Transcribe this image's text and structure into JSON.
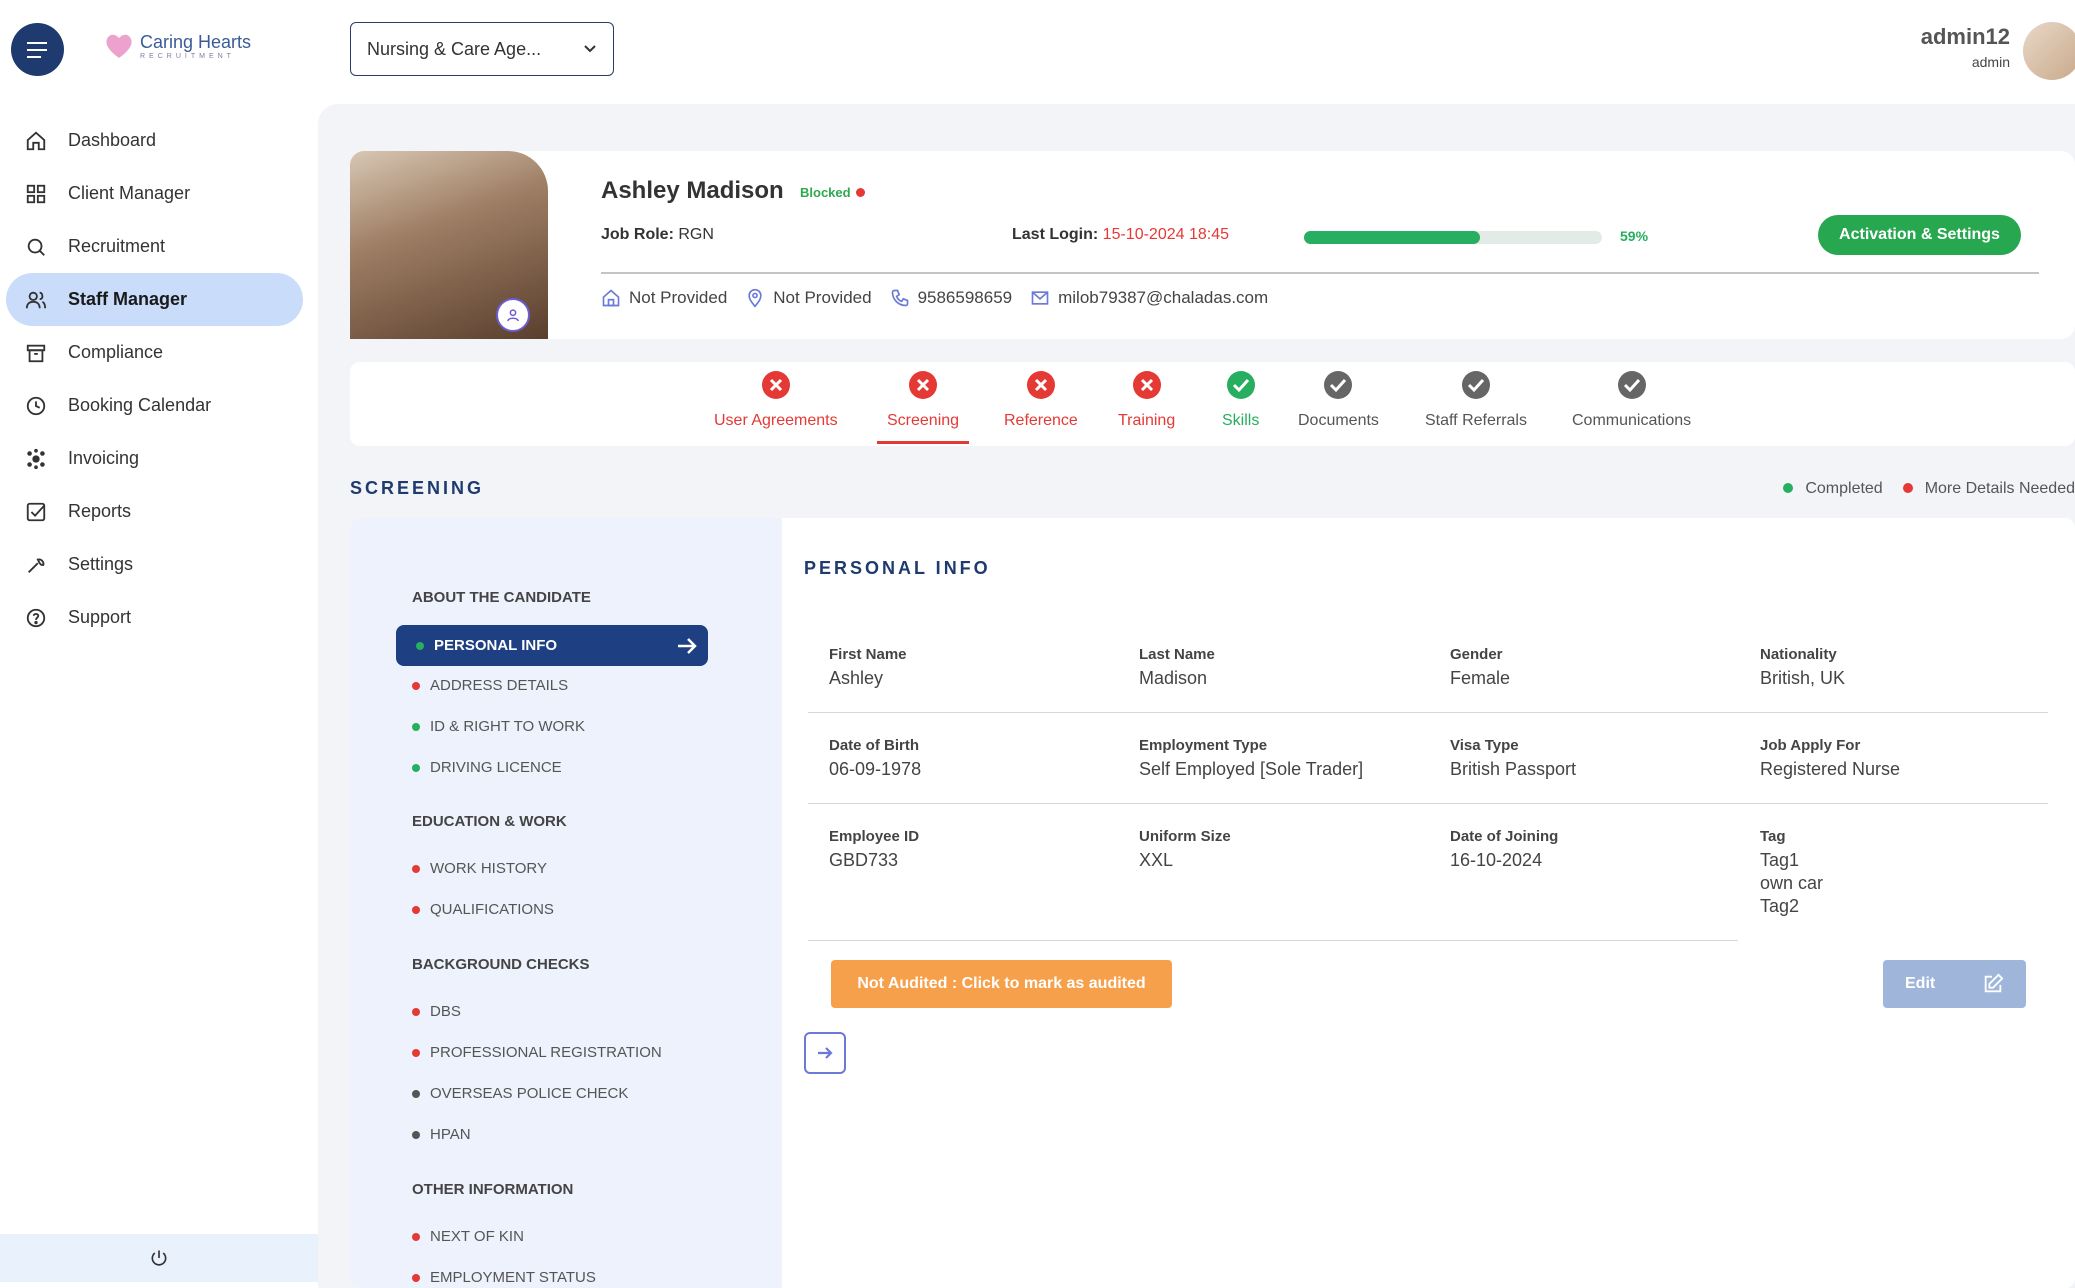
{
  "brand": {
    "name": "Caring Hearts",
    "sub": "RECRUITMENT"
  },
  "agency_select": {
    "value": "Nursing & Care Age..."
  },
  "user": {
    "name": "admin12",
    "role": "admin"
  },
  "sidebar": {
    "items": [
      {
        "label": "Dashboard",
        "icon": "home-icon"
      },
      {
        "label": "Client Manager",
        "icon": "grid-icon"
      },
      {
        "label": "Recruitment",
        "icon": "search-icon"
      },
      {
        "label": "Staff Manager",
        "icon": "users-icon"
      },
      {
        "label": "Compliance",
        "icon": "archive-icon"
      },
      {
        "label": "Booking Calendar",
        "icon": "clock-icon"
      },
      {
        "label": "Invoicing",
        "icon": "cog-icon"
      },
      {
        "label": "Reports",
        "icon": "checkbox-icon"
      },
      {
        "label": "Settings",
        "icon": "wrench-icon"
      },
      {
        "label": "Support",
        "icon": "help-icon"
      }
    ]
  },
  "candidate": {
    "name": "Ashley Madison",
    "status": "Blocked",
    "job_role_label": "Job Role:",
    "job_role": "RGN",
    "last_login_label": "Last Login:",
    "last_login": "15-10-2024 18:45",
    "progress": 59,
    "progress_label": "59%",
    "activation_button": "Activation & Settings",
    "address": "Not Provided",
    "location": "Not Provided",
    "phone": "9586598659",
    "email": "milob79387@chaladas.com"
  },
  "tabs": [
    {
      "label": "User Agreements",
      "state": "error"
    },
    {
      "label": "Screening",
      "state": "error"
    },
    {
      "label": "Reference",
      "state": "error"
    },
    {
      "label": "Training",
      "state": "error"
    },
    {
      "label": "Skills",
      "state": "complete"
    },
    {
      "label": "Documents",
      "state": "neutral"
    },
    {
      "label": "Staff Referrals",
      "state": "neutral"
    },
    {
      "label": "Communications",
      "state": "neutral"
    }
  ],
  "screening": {
    "title": "SCREENING",
    "legend": {
      "completed": "Completed",
      "more": "More Details Needed"
    },
    "groups": [
      {
        "title": "ABOUT THE CANDIDATE",
        "items": [
          {
            "label": "PERSONAL INFO",
            "status": "green"
          },
          {
            "label": "ADDRESS DETAILS",
            "status": "red"
          },
          {
            "label": "ID & RIGHT TO WORK",
            "status": "green"
          },
          {
            "label": "DRIVING LICENCE",
            "status": "green"
          }
        ]
      },
      {
        "title": "EDUCATION & WORK",
        "items": [
          {
            "label": "WORK HISTORY",
            "status": "red"
          },
          {
            "label": "QUALIFICATIONS",
            "status": "red"
          }
        ]
      },
      {
        "title": "BACKGROUND CHECKS",
        "items": [
          {
            "label": "DBS",
            "status": "red"
          },
          {
            "label": "PROFESSIONAL REGISTRATION",
            "status": "red"
          },
          {
            "label": "OVERSEAS POLICE CHECK",
            "status": "grey"
          },
          {
            "label": "HPAN",
            "status": "grey"
          }
        ]
      },
      {
        "title": "OTHER INFORMATION",
        "items": [
          {
            "label": "NEXT OF KIN",
            "status": "red"
          },
          {
            "label": "EMPLOYMENT STATUS",
            "status": "red"
          }
        ]
      }
    ]
  },
  "personal_info": {
    "title": "PERSONAL INFO",
    "fields": [
      {
        "label": "First Name",
        "value": "Ashley"
      },
      {
        "label": "Last Name",
        "value": "Madison"
      },
      {
        "label": "Gender",
        "value": "Female"
      },
      {
        "label": "Nationality",
        "value": "British, UK"
      },
      {
        "label": "Date of Birth",
        "value": "06-09-1978"
      },
      {
        "label": "Employment Type",
        "value": "Self Employed [Sole Trader]"
      },
      {
        "label": "Visa Type",
        "value": "British Passport"
      },
      {
        "label": "Job Apply For",
        "value": "Registered Nurse"
      },
      {
        "label": "Employee ID",
        "value": "GBD733"
      },
      {
        "label": "Uniform Size",
        "value": "XXL"
      },
      {
        "label": "Date of Joining",
        "value": "16-10-2024"
      },
      {
        "label": "Tag",
        "value": "Tag1"
      }
    ],
    "tags": [
      "Tag1",
      "own car",
      "Tag2"
    ],
    "audit_button": "Not Audited : Click to mark as audited",
    "edit_button": "Edit"
  },
  "colors": {
    "primary": "#1e3a6e",
    "success": "#27ae60",
    "danger": "#e53935",
    "warning": "#f7a04b"
  }
}
